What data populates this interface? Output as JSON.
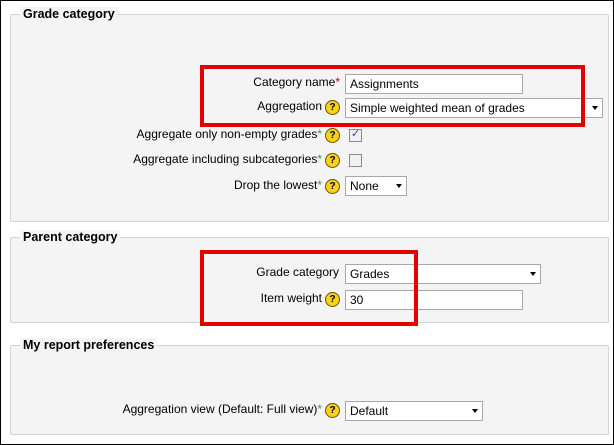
{
  "grade_category": {
    "legend": "Grade category",
    "category_name_label": "Category name",
    "category_name_value": "Assignments",
    "aggregation_label": "Aggregation",
    "aggregation_value": "Simple weighted mean of grades",
    "aggregate_nonempty_label": "Aggregate only non-empty grades",
    "aggregate_nonempty_checked": true,
    "aggregate_subcats_label": "Aggregate including subcategories",
    "aggregate_subcats_checked": false,
    "drop_lowest_label": "Drop the lowest",
    "drop_lowest_value": "None"
  },
  "parent_category": {
    "legend": "Parent category",
    "grade_category_label": "Grade category",
    "grade_category_value": "Grades",
    "item_weight_label": "Item weight",
    "item_weight_value": "30"
  },
  "report_prefs": {
    "legend": "My report preferences",
    "aggregation_view_label": "Aggregation view (Default: Full view)",
    "aggregation_view_value": "Default"
  },
  "markers": {
    "required": "*",
    "help": "?"
  },
  "colors": {
    "highlight": "#e30000",
    "required": "#cc0000",
    "advanced": "#2fa02f",
    "help": "#f7d21a"
  }
}
